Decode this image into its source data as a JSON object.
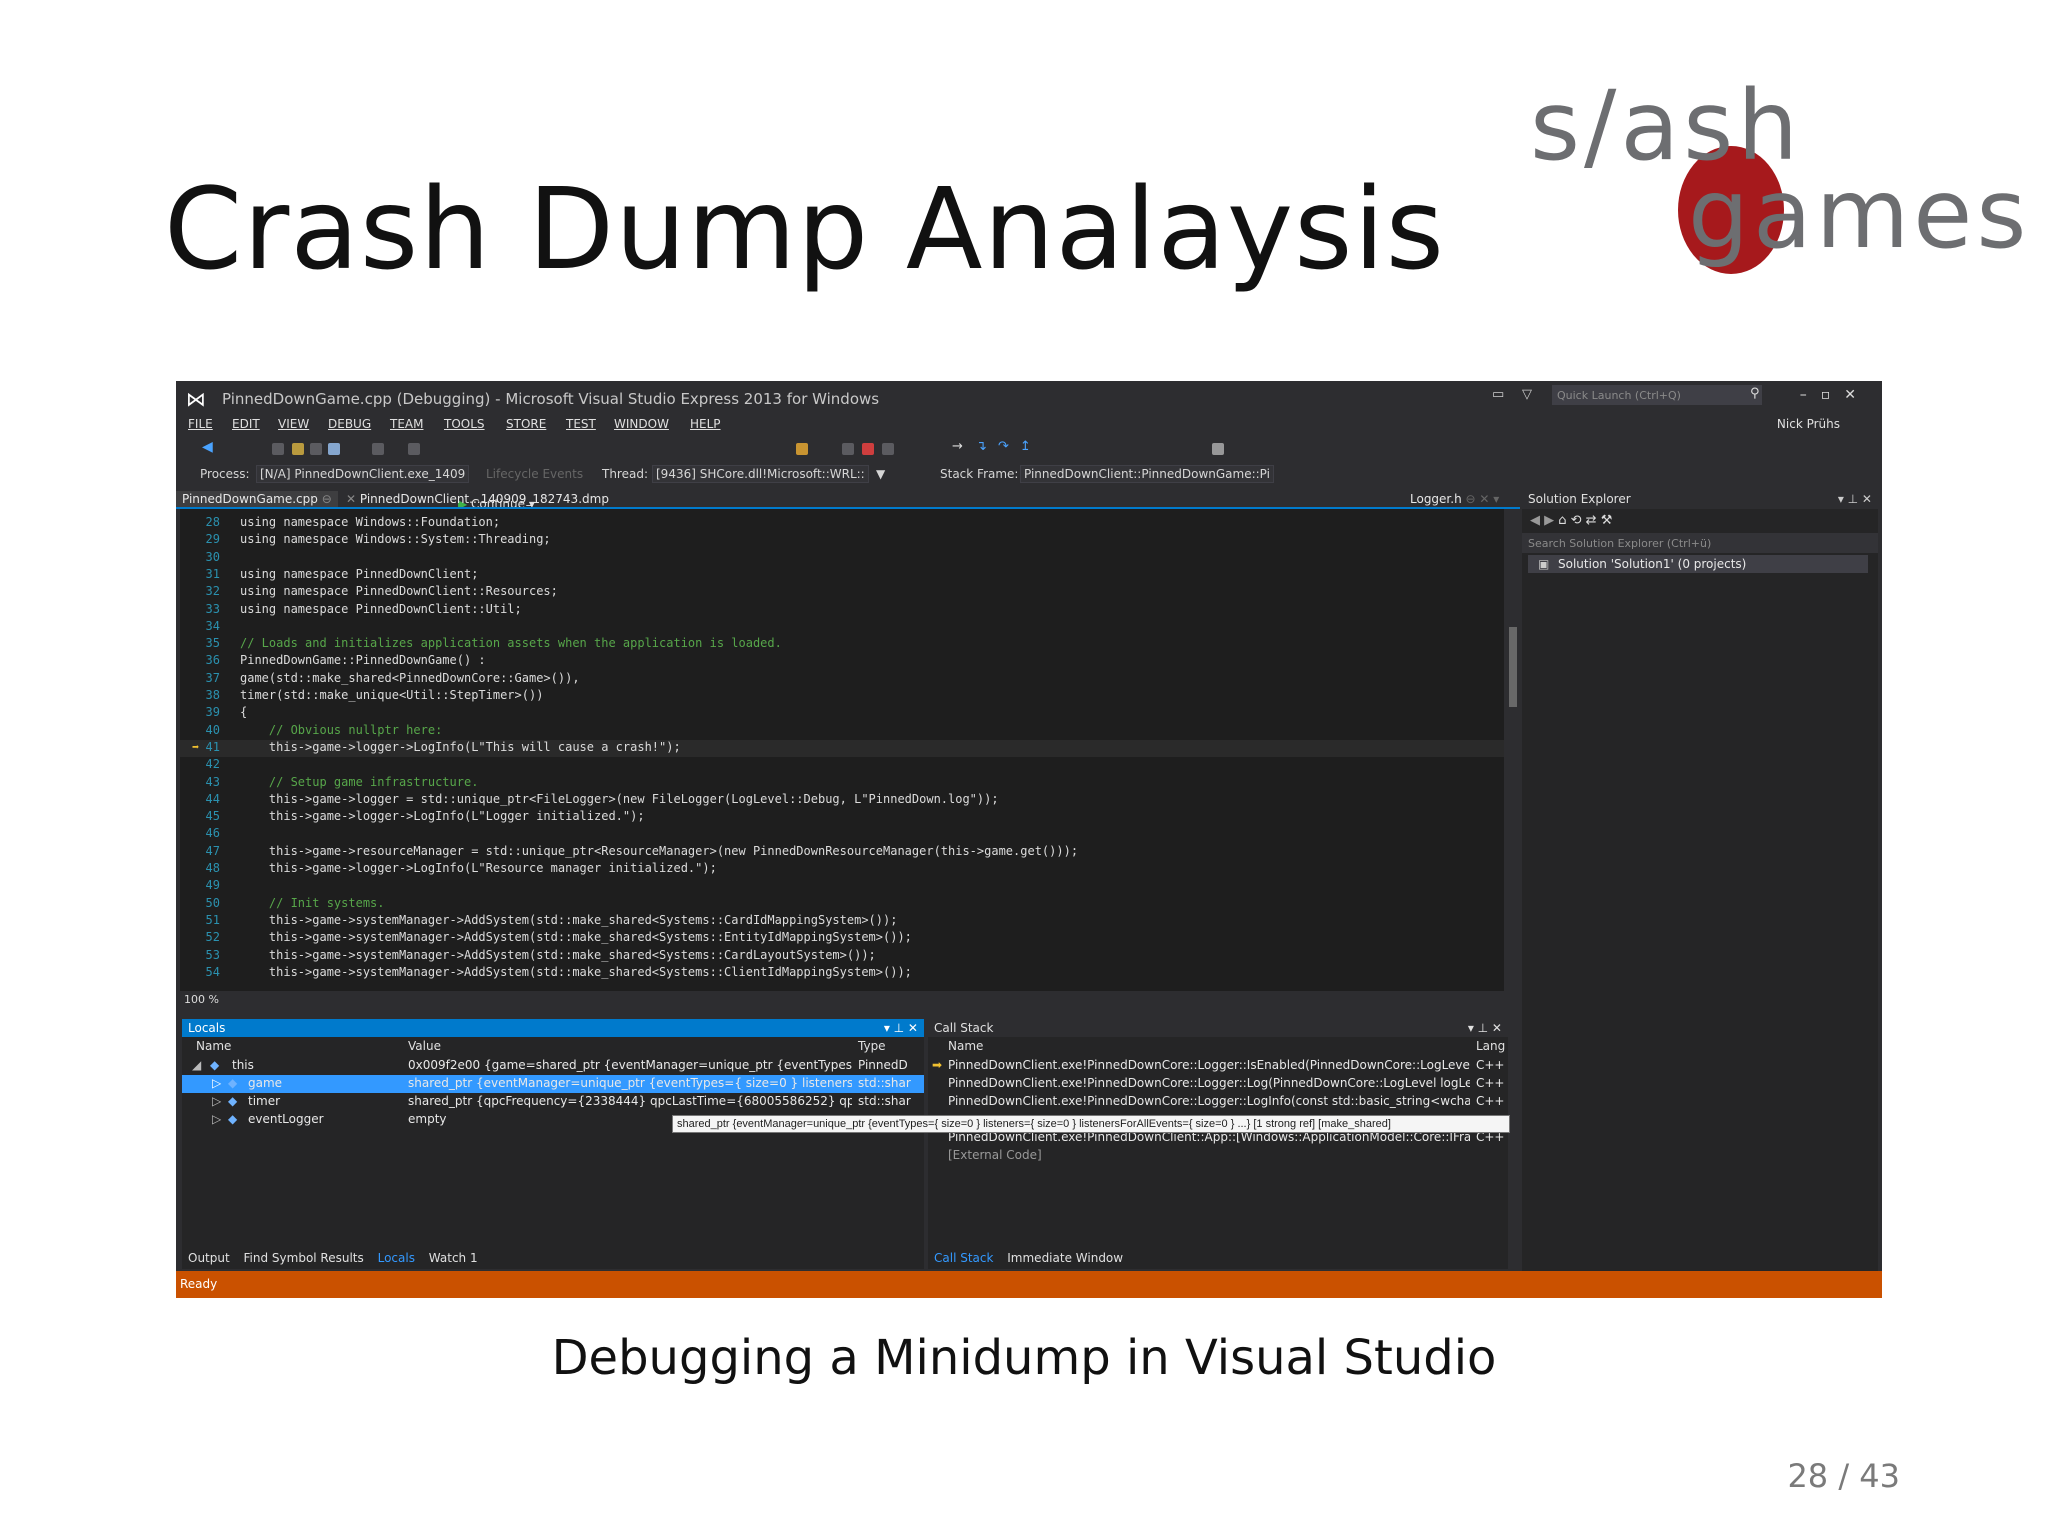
{
  "slide": {
    "title": "Crash Dump Analaysis",
    "caption": "Debugging a Minidump in Visual Studio",
    "page": "28 / 43",
    "logo": {
      "line1": "s/ash",
      "line2": "games",
      "accent_color": "#a6191c",
      "text_color": "#6d6e71"
    }
  },
  "vs": {
    "window_title": "PinnedDownGame.cpp (Debugging) - Microsoft Visual Studio Express 2013 for Windows",
    "quick_launch_placeholder": "Quick Launch (Ctrl+Q)",
    "user": "Nick Prühs",
    "menu": [
      "FILE",
      "EDIT",
      "VIEW",
      "DEBUG",
      "TEAM",
      "TOOLS",
      "STORE",
      "TEST",
      "WINDOW",
      "HELP"
    ],
    "continue_label": "Continue",
    "process_label": "Process:",
    "process_value": "[N/A] PinnedDownClient.exe_1409",
    "lifecycle_label": "Lifecycle Events",
    "thread_label": "Thread:",
    "thread_value": "[9436] SHCore.dll!Microsoft::WRL::",
    "stack_frame_label": "Stack Frame:",
    "stack_frame_value": "PinnedDownClient::PinnedDownGame::Pi",
    "tabs": [
      "PinnedDownGame.cpp",
      "PinnedDownClient...140909_182743.dmp"
    ],
    "right_tab": "Logger.h",
    "zoom": "100 %",
    "status": "Ready",
    "accent_color": "#007acc",
    "status_color": "#ca5100"
  },
  "code": [
    {
      "n": "28",
      "t": "using namespace Windows::Foundation;"
    },
    {
      "n": "29",
      "t": "using namespace Windows::System::Threading;"
    },
    {
      "n": "30",
      "t": ""
    },
    {
      "n": "31",
      "t": "using namespace PinnedDownClient;"
    },
    {
      "n": "32",
      "t": "using namespace PinnedDownClient::Resources;"
    },
    {
      "n": "33",
      "t": "using namespace PinnedDownClient::Util;"
    },
    {
      "n": "34",
      "t": ""
    },
    {
      "n": "35",
      "t": "// Loads and initializes application assets when the application is loaded."
    },
    {
      "n": "36",
      "t": "PinnedDownGame::PinnedDownGame() :"
    },
    {
      "n": "37",
      "t": "game(std::make_shared<PinnedDownCore::Game>()),"
    },
    {
      "n": "38",
      "t": "timer(std::make_unique<Util::StepTimer>())"
    },
    {
      "n": "39",
      "t": "{"
    },
    {
      "n": "40",
      "t": "    // Obvious nullptr here:"
    },
    {
      "n": "41",
      "t": "    this->game->logger->LogInfo(L\"This will cause a crash!\");"
    },
    {
      "n": "42",
      "t": ""
    },
    {
      "n": "43",
      "t": "    // Setup game infrastructure."
    },
    {
      "n": "44",
      "t": "    this->game->logger = std::unique_ptr<FileLogger>(new FileLogger(LogLevel::Debug, L\"PinnedDown.log\"));"
    },
    {
      "n": "45",
      "t": "    this->game->logger->LogInfo(L\"Logger initialized.\");"
    },
    {
      "n": "46",
      "t": ""
    },
    {
      "n": "47",
      "t": "    this->game->resourceManager = std::unique_ptr<ResourceManager>(new PinnedDownResourceManager(this->game.get()));"
    },
    {
      "n": "48",
      "t": "    this->game->logger->LogInfo(L\"Resource manager initialized.\");"
    },
    {
      "n": "49",
      "t": ""
    },
    {
      "n": "50",
      "t": "    // Init systems."
    },
    {
      "n": "51",
      "t": "    this->game->systemManager->AddSystem(std::make_shared<Systems::CardIdMappingSystem>());"
    },
    {
      "n": "52",
      "t": "    this->game->systemManager->AddSystem(std::make_shared<Systems::EntityIdMappingSystem>());"
    },
    {
      "n": "53",
      "t": "    this->game->systemManager->AddSystem(std::make_shared<Systems::CardLayoutSystem>());"
    },
    {
      "n": "54",
      "t": "    this->game->systemManager->AddSystem(std::make_shared<Systems::ClientIdMappingSystem>());"
    }
  ],
  "solution_explorer": {
    "title": "Solution Explorer",
    "search_placeholder": "Search Solution Explorer (Ctrl+ü)",
    "item": "Solution 'Solution1' (0 projects)"
  },
  "locals": {
    "title": "Locals",
    "cols": [
      "Name",
      "Value",
      "Type"
    ],
    "rows": [
      {
        "name": "this",
        "value": "0x009f2e00 {game=shared_ptr {eventManager=unique_ptr {eventTypes={ size=",
        "type": "PinnedD"
      },
      {
        "name": "game",
        "value": "shared_ptr {eventManager=unique_ptr {eventTypes={ size=0 } listeners={ size=",
        "type": "std::shar"
      },
      {
        "name": "timer",
        "value": "shared_ptr {qpcFrequency={2338444} qpcLastTime={68005586252} qpcMaxDelt",
        "type": "std::shar"
      },
      {
        "name": "eventLogger",
        "value": "empty",
        "type": ""
      }
    ],
    "tooltip": "shared_ptr {eventManager=unique_ptr {eventTypes={ size=0 } listeners={ size=0 } listenersForAllEvents={ size=0 } ...} [1 strong ref] [make_shared]"
  },
  "callstack": {
    "title": "Call Stack",
    "cols": [
      "Name",
      "Lang"
    ],
    "rows": [
      {
        "name": "PinnedDownClient.exe!PinnedDownCore::Logger::IsEnabled(PinnedDownCore::LogLevel logI",
        "lang": "C++"
      },
      {
        "name": "PinnedDownClient.exe!PinnedDownCore::Logger::Log(PinnedDownCore::LogLevel logLevel,",
        "lang": "C++"
      },
      {
        "name": "PinnedDownClient.exe!PinnedDownCore::Logger::LogInfo(const std::basic_string<wchar_t,st",
        "lang": "C++"
      },
      {
        "name": "PinnedDownClient.exe!PinnedDownClient::App::[Windows::ApplicationModel::Core::IFramev",
        "lang": "C++"
      },
      {
        "name": "[External Code]",
        "lang": ""
      }
    ]
  },
  "bottom_tabs_left": [
    "Output",
    "Find Symbol Results",
    "Locals",
    "Watch 1"
  ],
  "bottom_tabs_right": [
    "Call Stack",
    "Immediate Window"
  ]
}
